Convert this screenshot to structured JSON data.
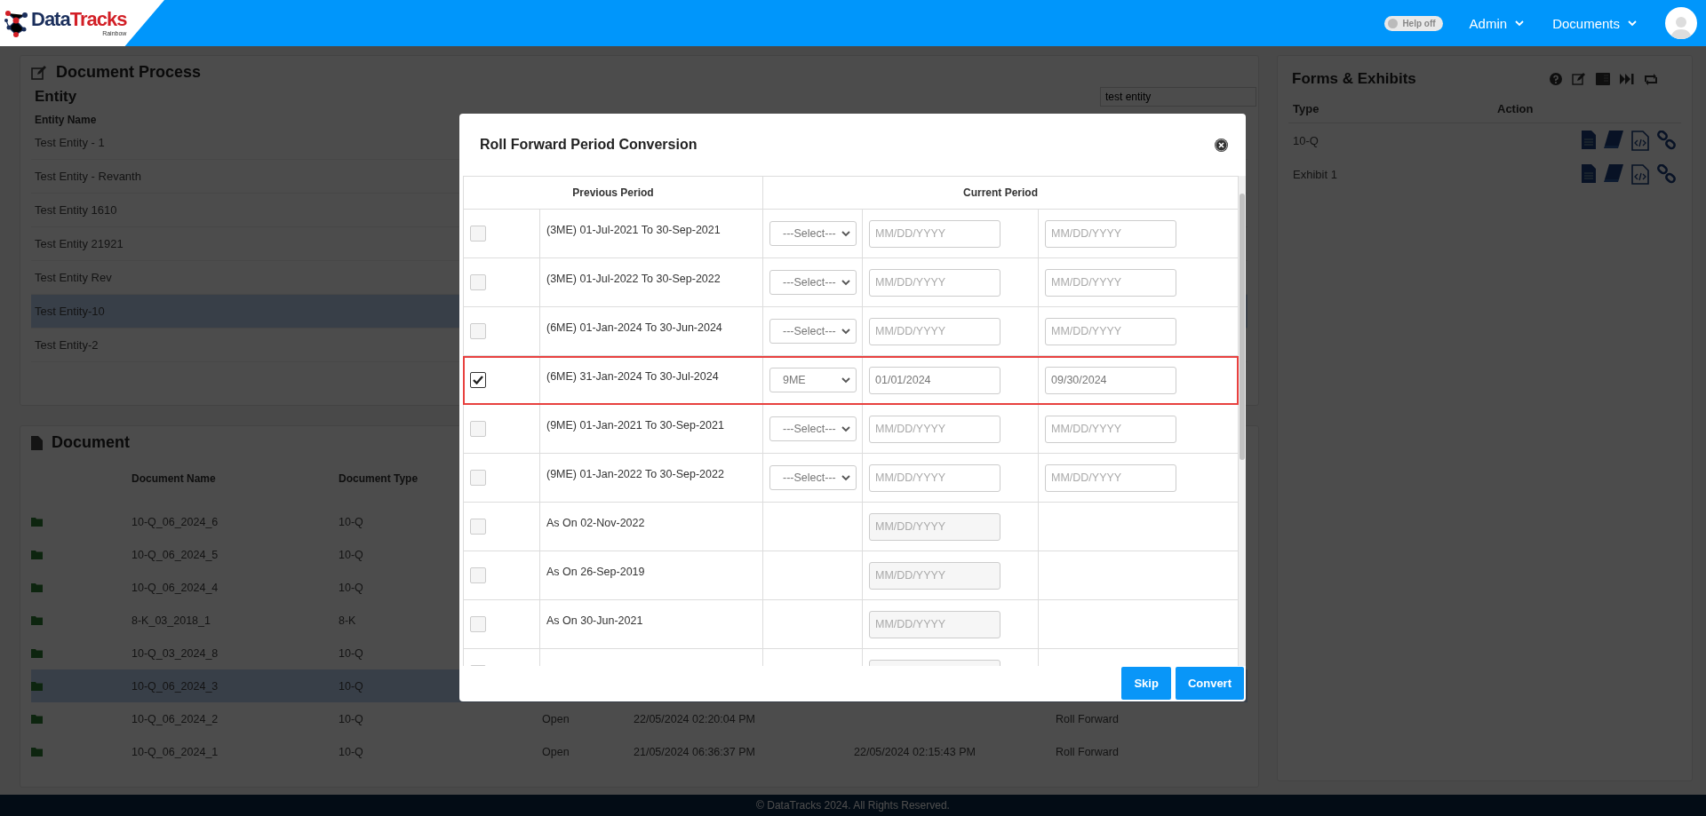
{
  "header": {
    "logo": {
      "part_1": "Data",
      "part_2": "Tracks",
      "tagline": "Rainbow"
    },
    "help": {
      "label": "Help off",
      "on": false
    },
    "menus": [
      "Admin",
      "Documents"
    ]
  },
  "process": {
    "title": "Document Process",
    "entity": {
      "title": "Entity",
      "search_value": "test entity",
      "column": "Entity Name",
      "rows": [
        {
          "name": "Test Entity - 1",
          "selected": false
        },
        {
          "name": "Test Entity - Revanth",
          "selected": false
        },
        {
          "name": "Test Entity 1610",
          "selected": false
        },
        {
          "name": "Test Entity 21921",
          "selected": false
        },
        {
          "name": "Test Entity Rev",
          "selected": false
        },
        {
          "name": "Test Entity-10",
          "selected": true
        },
        {
          "name": "Test Entity-2",
          "selected": false
        }
      ]
    }
  },
  "document": {
    "title": "Document",
    "columns": [
      "Document Name",
      "Document Type"
    ],
    "rows": [
      {
        "name": "10-Q_06_2024_6",
        "type": "10-Q",
        "selected": false
      },
      {
        "name": "10-Q_06_2024_5",
        "type": "10-Q",
        "selected": false
      },
      {
        "name": "10-Q_06_2024_4",
        "type": "10-Q",
        "selected": false
      },
      {
        "name": "8-K_03_2018_1",
        "type": "8-K",
        "selected": false
      },
      {
        "name": "10-Q_03_2024_8",
        "type": "10-Q",
        "selected": false
      },
      {
        "name": "10-Q_06_2024_3",
        "type": "10-Q",
        "selected": true
      },
      {
        "name": "10-Q_06_2024_2",
        "type": "10-Q",
        "selected": false,
        "status": "Open",
        "created": "22/05/2024 02:20:04 PM",
        "action": "Roll Forward"
      },
      {
        "name": "10-Q_06_2024_1",
        "type": "10-Q",
        "selected": false,
        "status": "Open",
        "created": "21/05/2024 06:36:37 PM",
        "modified": "22/05/2024 02:15:43 PM",
        "action": "Roll Forward"
      }
    ]
  },
  "forms": {
    "title": "Forms & Exhibits",
    "columns": [
      "Type",
      "Action"
    ],
    "rows": [
      {
        "type": "10-Q"
      },
      {
        "type": "Exhibit 1"
      }
    ]
  },
  "footer": "© DataTracks 2024. All Rights Reserved.",
  "modal": {
    "title": "Roll Forward Period Conversion",
    "columns": [
      "Previous Period",
      "Current Period"
    ],
    "rows": [
      {
        "kind": "range",
        "period": "(3ME) 01-Jul-2021 To 30-Sep-2021",
        "checked": false,
        "highlighted": false,
        "select": "---Select---",
        "from_placeholder": "MM/DD/YYYY",
        "to_placeholder": "MM/DD/YYYY"
      },
      {
        "kind": "range",
        "period": "(3ME) 01-Jul-2022 To 30-Sep-2022",
        "checked": false,
        "highlighted": false,
        "select": "---Select---",
        "from_placeholder": "MM/DD/YYYY",
        "to_placeholder": "MM/DD/YYYY"
      },
      {
        "kind": "range",
        "period": "(6ME) 01-Jan-2024 To 30-Jun-2024",
        "checked": false,
        "highlighted": false,
        "select": "---Select---",
        "from_placeholder": "MM/DD/YYYY",
        "to_placeholder": "MM/DD/YYYY"
      },
      {
        "kind": "range",
        "period": "(6ME) 31-Jan-2024 To 30-Jul-2024",
        "checked": true,
        "highlighted": true,
        "select": "9ME",
        "from_value": "01/01/2024",
        "to_value": "09/30/2024"
      },
      {
        "kind": "range",
        "period": "(9ME) 01-Jan-2021 To 30-Sep-2021",
        "checked": false,
        "highlighted": false,
        "select": "---Select---",
        "from_placeholder": "MM/DD/YYYY",
        "to_placeholder": "MM/DD/YYYY"
      },
      {
        "kind": "range",
        "period": "(9ME) 01-Jan-2022 To 30-Sep-2022",
        "checked": false,
        "highlighted": false,
        "select": "---Select---",
        "from_placeholder": "MM/DD/YYYY",
        "to_placeholder": "MM/DD/YYYY"
      },
      {
        "kind": "as_on",
        "period": "As On 02-Nov-2022",
        "checked": false,
        "highlighted": false,
        "from_placeholder": "MM/DD/YYYY"
      },
      {
        "kind": "as_on",
        "period": "As On 26-Sep-2019",
        "checked": false,
        "highlighted": false,
        "from_placeholder": "MM/DD/YYYY"
      },
      {
        "kind": "as_on",
        "period": "As On 30-Jun-2021",
        "checked": false,
        "highlighted": false,
        "from_placeholder": "MM/DD/YYYY"
      },
      {
        "kind": "as_on",
        "checked": false,
        "highlighted": false
      }
    ],
    "buttons": [
      "Skip",
      "Convert"
    ]
  }
}
